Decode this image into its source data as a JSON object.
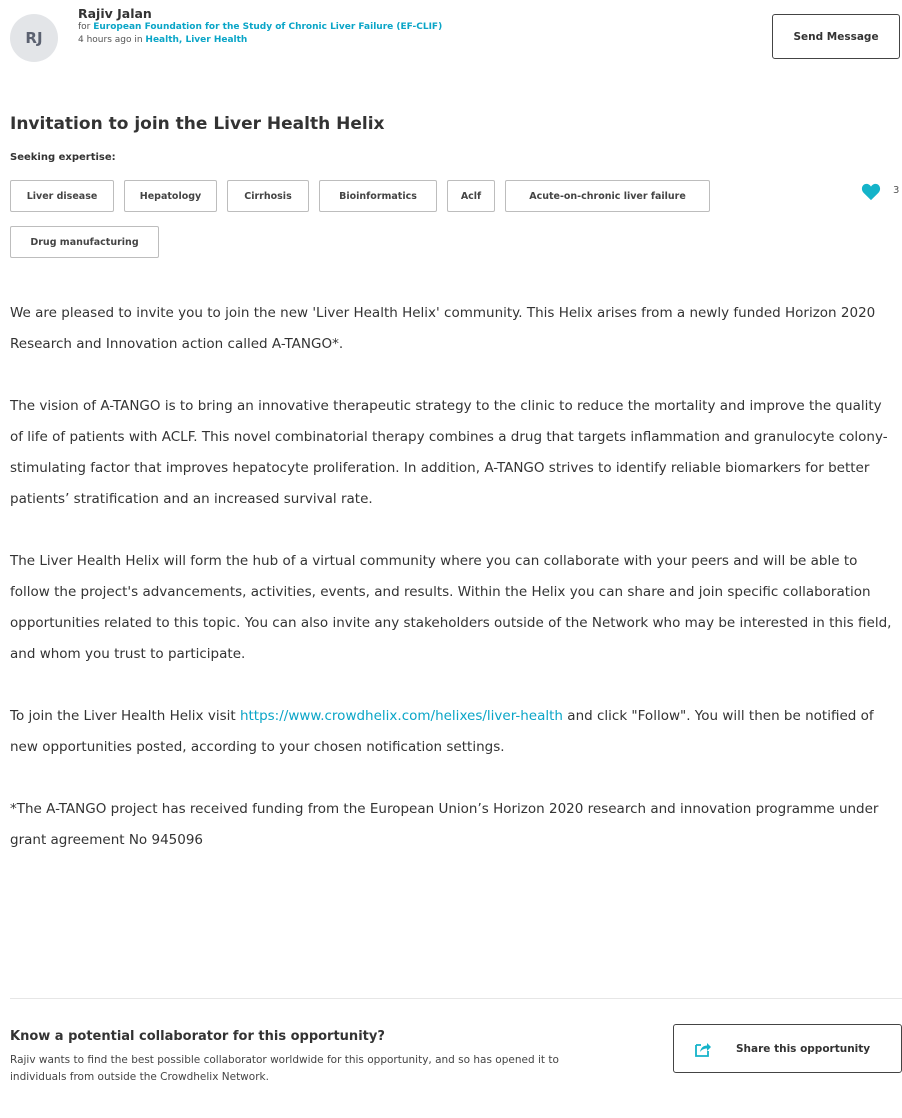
{
  "author": {
    "initials": "RJ",
    "name": "Rajiv Jalan",
    "for_prefix": "for ",
    "organization": "European Foundation for the Study of Chronic Liver Failure (EF-CLIF)",
    "time_prefix": "4 hours ago in ",
    "categories": "Health, Liver Health"
  },
  "actions": {
    "send_message": "Send Message",
    "share": "Share this opportunity"
  },
  "post": {
    "title": "Invitation to join the Liver Health Helix",
    "seeking_label": "Seeking expertise:",
    "tags": [
      "Liver disease",
      "Hepatology",
      "Cirrhosis",
      "Bioinformatics",
      "Aclf",
      "Acute-on-chronic liver failure",
      "Drug manufacturing"
    ],
    "like_count": "3",
    "paragraphs": {
      "p1": "We are pleased to invite you to join the new 'Liver Health Helix' community. This Helix arises from a newly funded Horizon 2020 Research and Innovation action called A-TANGO*.",
      "p2": "The vision of A-TANGO is to bring an innovative therapeutic strategy to the clinic to reduce the mortality and improve the quality of life of patients with ACLF. This novel combinatorial therapy combines a drug that targets inflammation and granulocyte colony-stimulating factor that improves hepatocyte proliferation. In addition, A-TANGO strives to identify reliable biomarkers for better patients’ stratification and an increased survival rate.",
      "p3": "The Liver Health Helix will form the hub of a virtual community where you can collaborate with your peers and will be able to follow the project's advancements, activities, events, and results. Within the Helix you can share and join specific collaboration opportunities related to this topic. You can also invite any stakeholders outside of the Network who may be interested in this field, and whom you trust to participate.",
      "p4_before": "To join the Liver Health Helix visit ",
      "p4_link": "https://www.crowdhelix.com/helixes/liver-health",
      "p4_after": " and click \"Follow\". You will then be notified of new opportunities posted, according to your chosen notification settings.",
      "p5": "*The A-TANGO project has received funding from the European Union’s Horizon 2020 research and innovation programme under grant agreement No 945096"
    }
  },
  "collaborator": {
    "title": "Know a potential collaborator for this opportunity?",
    "text": "Rajiv wants to find the best possible collaborator worldwide for this opportunity, and so has opened it to individuals from outside the Crowdhelix Network."
  },
  "colors": {
    "link": "#0aa5c7",
    "heart": "#14b3c9",
    "text": "#333333"
  },
  "icons": {
    "like": "heart-icon",
    "share": "share-icon"
  }
}
